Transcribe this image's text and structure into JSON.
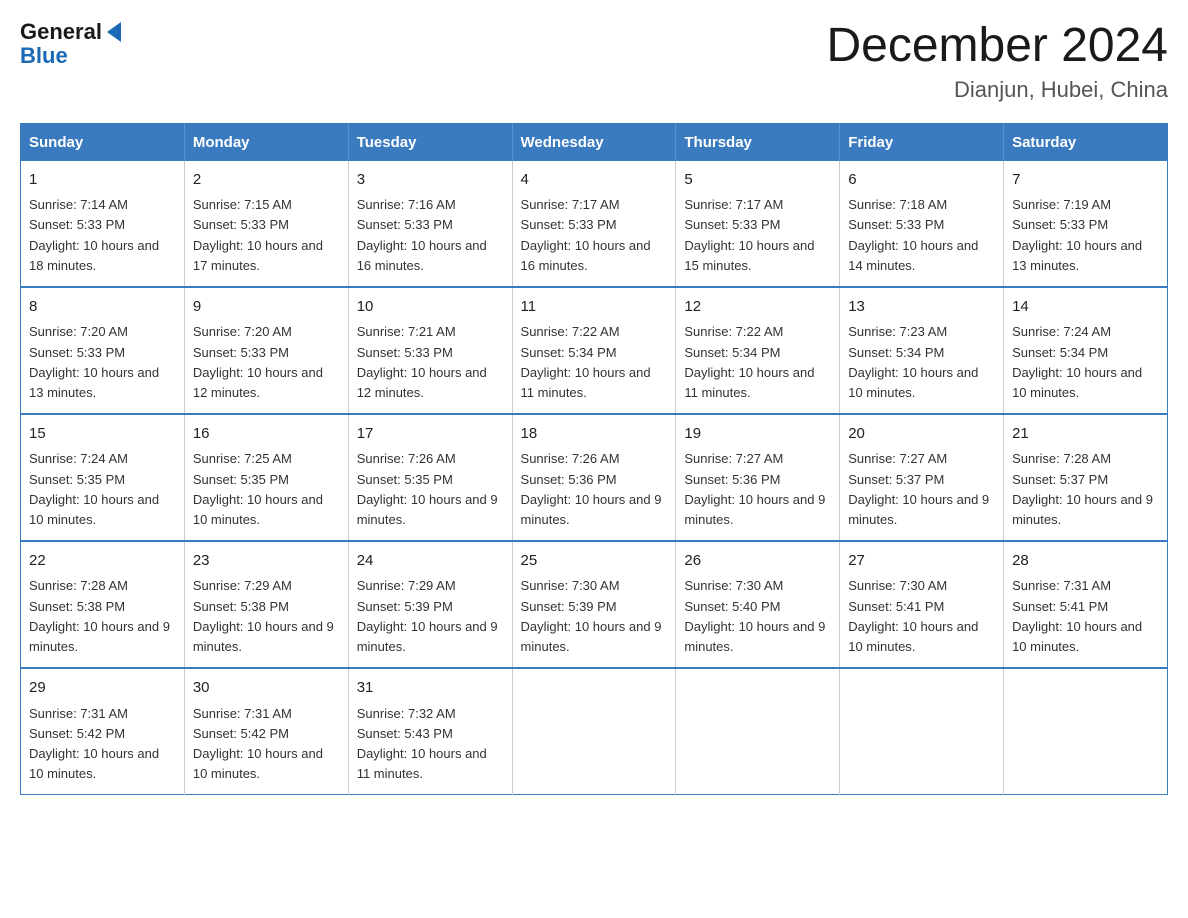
{
  "logo": {
    "general": "General",
    "blue": "Blue"
  },
  "title": "December 2024",
  "location": "Dianjun, Hubei, China",
  "days_of_week": [
    "Sunday",
    "Monday",
    "Tuesday",
    "Wednesday",
    "Thursday",
    "Friday",
    "Saturday"
  ],
  "weeks": [
    [
      {
        "day": 1,
        "sunrise": "7:14 AM",
        "sunset": "5:33 PM",
        "daylight": "10 hours and 18 minutes."
      },
      {
        "day": 2,
        "sunrise": "7:15 AM",
        "sunset": "5:33 PM",
        "daylight": "10 hours and 17 minutes."
      },
      {
        "day": 3,
        "sunrise": "7:16 AM",
        "sunset": "5:33 PM",
        "daylight": "10 hours and 16 minutes."
      },
      {
        "day": 4,
        "sunrise": "7:17 AM",
        "sunset": "5:33 PM",
        "daylight": "10 hours and 16 minutes."
      },
      {
        "day": 5,
        "sunrise": "7:17 AM",
        "sunset": "5:33 PM",
        "daylight": "10 hours and 15 minutes."
      },
      {
        "day": 6,
        "sunrise": "7:18 AM",
        "sunset": "5:33 PM",
        "daylight": "10 hours and 14 minutes."
      },
      {
        "day": 7,
        "sunrise": "7:19 AM",
        "sunset": "5:33 PM",
        "daylight": "10 hours and 13 minutes."
      }
    ],
    [
      {
        "day": 8,
        "sunrise": "7:20 AM",
        "sunset": "5:33 PM",
        "daylight": "10 hours and 13 minutes."
      },
      {
        "day": 9,
        "sunrise": "7:20 AM",
        "sunset": "5:33 PM",
        "daylight": "10 hours and 12 minutes."
      },
      {
        "day": 10,
        "sunrise": "7:21 AM",
        "sunset": "5:33 PM",
        "daylight": "10 hours and 12 minutes."
      },
      {
        "day": 11,
        "sunrise": "7:22 AM",
        "sunset": "5:34 PM",
        "daylight": "10 hours and 11 minutes."
      },
      {
        "day": 12,
        "sunrise": "7:22 AM",
        "sunset": "5:34 PM",
        "daylight": "10 hours and 11 minutes."
      },
      {
        "day": 13,
        "sunrise": "7:23 AM",
        "sunset": "5:34 PM",
        "daylight": "10 hours and 10 minutes."
      },
      {
        "day": 14,
        "sunrise": "7:24 AM",
        "sunset": "5:34 PM",
        "daylight": "10 hours and 10 minutes."
      }
    ],
    [
      {
        "day": 15,
        "sunrise": "7:24 AM",
        "sunset": "5:35 PM",
        "daylight": "10 hours and 10 minutes."
      },
      {
        "day": 16,
        "sunrise": "7:25 AM",
        "sunset": "5:35 PM",
        "daylight": "10 hours and 10 minutes."
      },
      {
        "day": 17,
        "sunrise": "7:26 AM",
        "sunset": "5:35 PM",
        "daylight": "10 hours and 9 minutes."
      },
      {
        "day": 18,
        "sunrise": "7:26 AM",
        "sunset": "5:36 PM",
        "daylight": "10 hours and 9 minutes."
      },
      {
        "day": 19,
        "sunrise": "7:27 AM",
        "sunset": "5:36 PM",
        "daylight": "10 hours and 9 minutes."
      },
      {
        "day": 20,
        "sunrise": "7:27 AM",
        "sunset": "5:37 PM",
        "daylight": "10 hours and 9 minutes."
      },
      {
        "day": 21,
        "sunrise": "7:28 AM",
        "sunset": "5:37 PM",
        "daylight": "10 hours and 9 minutes."
      }
    ],
    [
      {
        "day": 22,
        "sunrise": "7:28 AM",
        "sunset": "5:38 PM",
        "daylight": "10 hours and 9 minutes."
      },
      {
        "day": 23,
        "sunrise": "7:29 AM",
        "sunset": "5:38 PM",
        "daylight": "10 hours and 9 minutes."
      },
      {
        "day": 24,
        "sunrise": "7:29 AM",
        "sunset": "5:39 PM",
        "daylight": "10 hours and 9 minutes."
      },
      {
        "day": 25,
        "sunrise": "7:30 AM",
        "sunset": "5:39 PM",
        "daylight": "10 hours and 9 minutes."
      },
      {
        "day": 26,
        "sunrise": "7:30 AM",
        "sunset": "5:40 PM",
        "daylight": "10 hours and 9 minutes."
      },
      {
        "day": 27,
        "sunrise": "7:30 AM",
        "sunset": "5:41 PM",
        "daylight": "10 hours and 10 minutes."
      },
      {
        "day": 28,
        "sunrise": "7:31 AM",
        "sunset": "5:41 PM",
        "daylight": "10 hours and 10 minutes."
      }
    ],
    [
      {
        "day": 29,
        "sunrise": "7:31 AM",
        "sunset": "5:42 PM",
        "daylight": "10 hours and 10 minutes."
      },
      {
        "day": 30,
        "sunrise": "7:31 AM",
        "sunset": "5:42 PM",
        "daylight": "10 hours and 10 minutes."
      },
      {
        "day": 31,
        "sunrise": "7:32 AM",
        "sunset": "5:43 PM",
        "daylight": "10 hours and 11 minutes."
      },
      null,
      null,
      null,
      null
    ]
  ]
}
